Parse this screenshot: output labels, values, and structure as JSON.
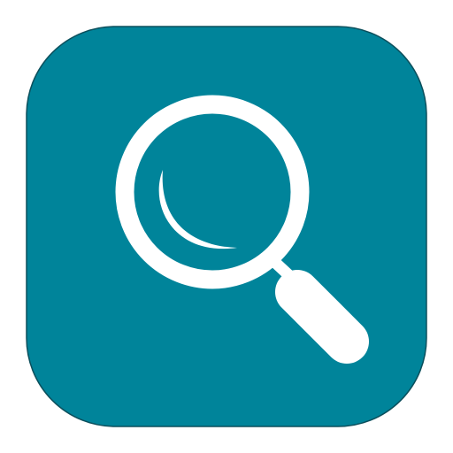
{
  "icon": {
    "name": "search",
    "glyph": "magnifying-glass-icon"
  },
  "colors": {
    "tile": "#00849a",
    "tile_border": "#0b4f5c",
    "glyph": "#ffffff",
    "background": "#ffffff"
  }
}
